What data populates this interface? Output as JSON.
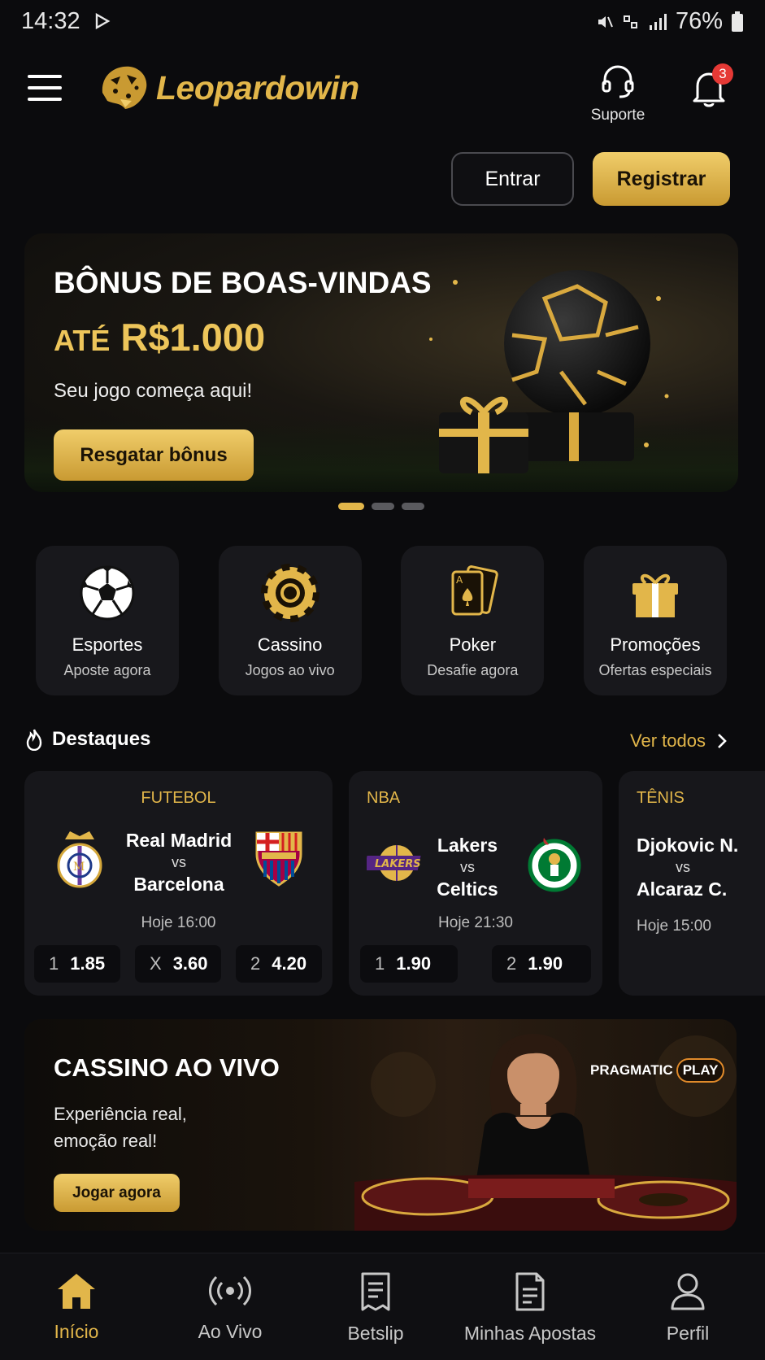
{
  "status_bar": {
    "time": "14:32",
    "battery": "76%"
  },
  "header": {
    "brand": "Leopardowin",
    "support_label": "Suporte",
    "notification_count": "3",
    "login_label": "Entrar",
    "register_label": "Registrar"
  },
  "hero": {
    "title": "BÔNUS DE BOAS-VINDAS",
    "amount_prefix": "ATÉ",
    "amount": "R$1.000",
    "subtitle": "Seu jogo começa aqui!",
    "cta": "Resgatar bônus",
    "slides": 3,
    "active_slide": 1
  },
  "categories": [
    {
      "name": "Esportes",
      "sub": "Aposte agora",
      "icon": "soccer-ball-icon"
    },
    {
      "name": "Cassino",
      "sub": "Jogos ao vivo",
      "icon": "casino-chip-icon"
    },
    {
      "name": "Poker",
      "sub": "Desafie agora",
      "icon": "playing-cards-icon"
    },
    {
      "name": "Promoções",
      "sub": "Ofertas especiais",
      "icon": "gift-icon"
    }
  ],
  "highlights": {
    "title": "Destaques",
    "see_all": "Ver todos",
    "matches": [
      {
        "sport": "FUTEBOL",
        "home": "Real Madrid",
        "vs": "vs",
        "away": "Barcelona",
        "time": "Hoje 16:00",
        "odds": [
          {
            "k": "1",
            "v": "1.85"
          },
          {
            "k": "X",
            "v": "3.60"
          },
          {
            "k": "2",
            "v": "4.20"
          }
        ]
      },
      {
        "sport": "NBA",
        "home": "Lakers",
        "vs": "vs",
        "away": "Celtics",
        "time": "Hoje 21:30",
        "odds": [
          {
            "k": "1",
            "v": "1.90"
          },
          {
            "k": "2",
            "v": "1.90"
          }
        ]
      },
      {
        "sport": "TÊNIS",
        "home": "Djokovic N.",
        "vs": "vs",
        "away": "Alcaraz C.",
        "time": "Hoje 15:00"
      }
    ]
  },
  "live_casino": {
    "title": "CASSINO AO VIVO",
    "subtitle": "Experiência real, emoção real!",
    "cta": "Jogar agora",
    "provider_a": "PRAGMATIC",
    "provider_b": "PLAY"
  },
  "bottom_nav": [
    {
      "label": "Início",
      "icon": "home-icon",
      "active": true
    },
    {
      "label": "Ao Vivo",
      "icon": "live-broadcast-icon"
    },
    {
      "label": "Betslip",
      "icon": "betslip-icon"
    },
    {
      "label": "Minhas Apostas",
      "icon": "my-bets-icon"
    },
    {
      "label": "Perfil",
      "icon": "profile-icon"
    }
  ],
  "colors": {
    "accent": "#e2b64a",
    "background": "#0b0b0d",
    "card": "#18181c",
    "badge": "#e53935"
  }
}
